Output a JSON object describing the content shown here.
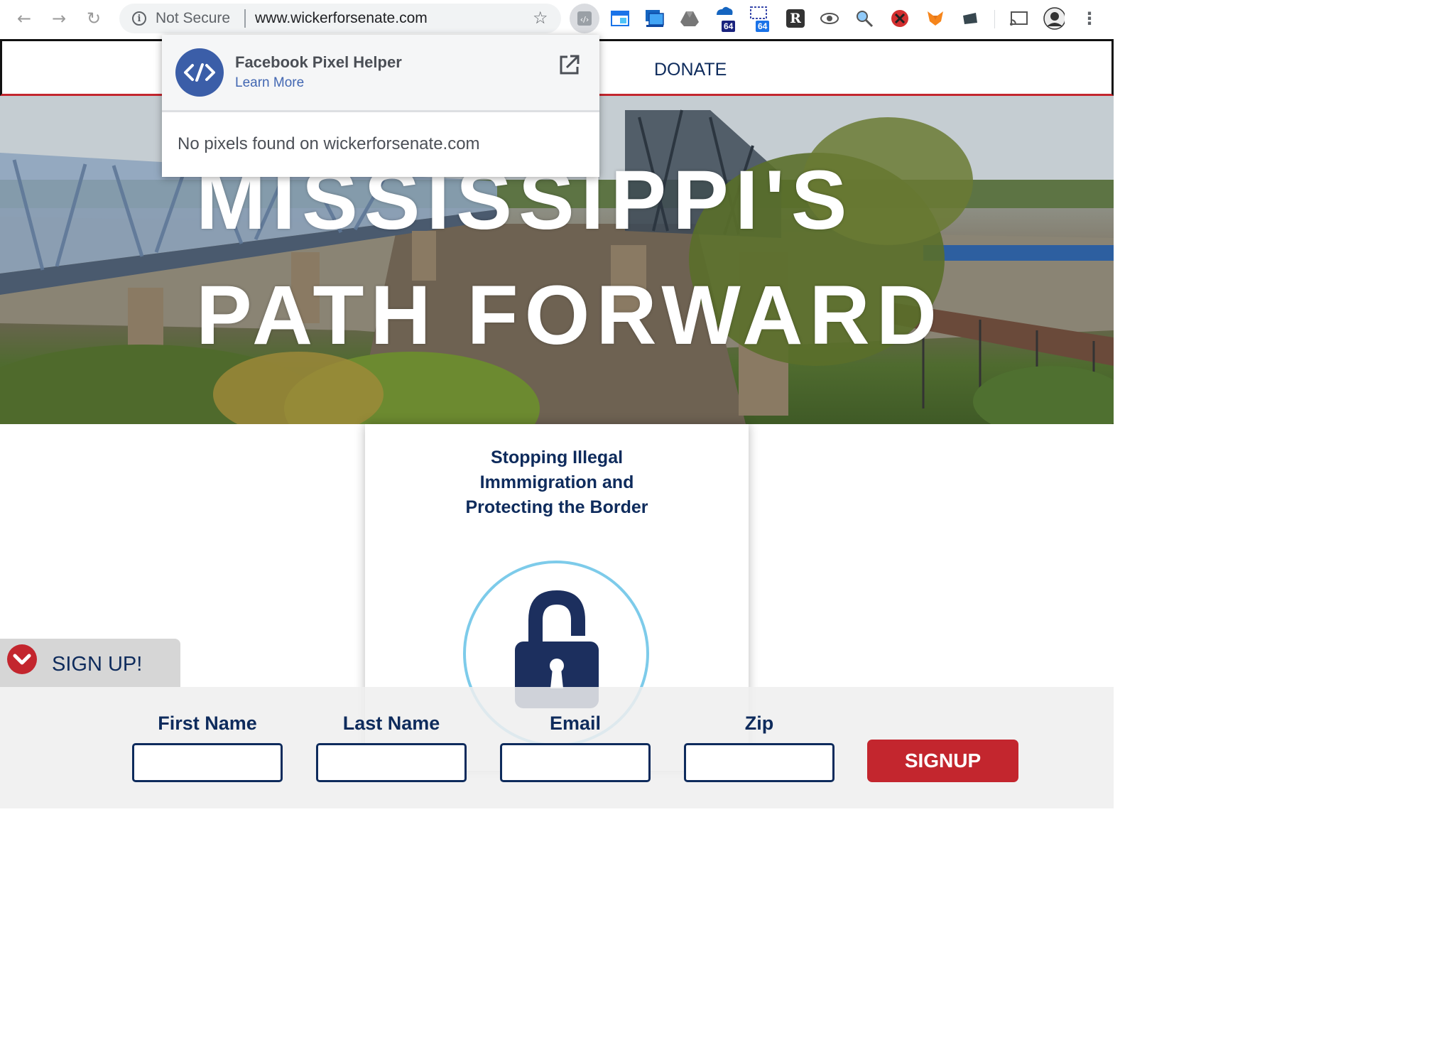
{
  "browser": {
    "security_label": "Not Secure",
    "url": "www.wickerforsenate.com",
    "extensions": [
      {
        "name": "facebook-pixel-helper-icon",
        "active": true
      },
      {
        "name": "window-icon"
      },
      {
        "name": "screen-capture-icon"
      },
      {
        "name": "drive-icon"
      },
      {
        "name": "cloud-extension-icon",
        "badge": "64",
        "badge_color": "#1a237e"
      },
      {
        "name": "network-extension-icon",
        "badge": "64",
        "badge_color": "#1a73e8"
      },
      {
        "name": "readability-icon",
        "glyph": "R"
      },
      {
        "name": "eye-icon"
      },
      {
        "name": "search-extension-icon"
      },
      {
        "name": "blocker-icon"
      },
      {
        "name": "fox-icon"
      },
      {
        "name": "tag-icon"
      },
      {
        "name": "cast-icon"
      },
      {
        "name": "profile-avatar"
      },
      {
        "name": "menu-icon"
      }
    ]
  },
  "site": {
    "nav": {
      "donate_label": "DONATE"
    },
    "hero": {
      "line1": "MISSISSIPPI'S",
      "line2": "PATH FORWARD"
    },
    "card": {
      "title_lines": [
        "Stopping Illegal",
        "Immmigration and",
        "Protecting the Border"
      ]
    },
    "signup": {
      "tab_label": "SIGN UP!",
      "fields": [
        {
          "label": "First Name",
          "value": ""
        },
        {
          "label": "Last Name",
          "value": ""
        },
        {
          "label": "Email",
          "value": ""
        },
        {
          "label": "Zip",
          "value": ""
        }
      ],
      "button_label": "SIGNUP"
    }
  },
  "popup": {
    "title": "Facebook Pixel Helper",
    "link": "Learn More",
    "message": "No pixels found on wickerforsenate.com"
  },
  "colors": {
    "brand_navy": "#0e2b5c",
    "brand_red": "#c3262e",
    "facebook_blue": "#3b5ea8",
    "lock_ring": "#7dcbea"
  }
}
